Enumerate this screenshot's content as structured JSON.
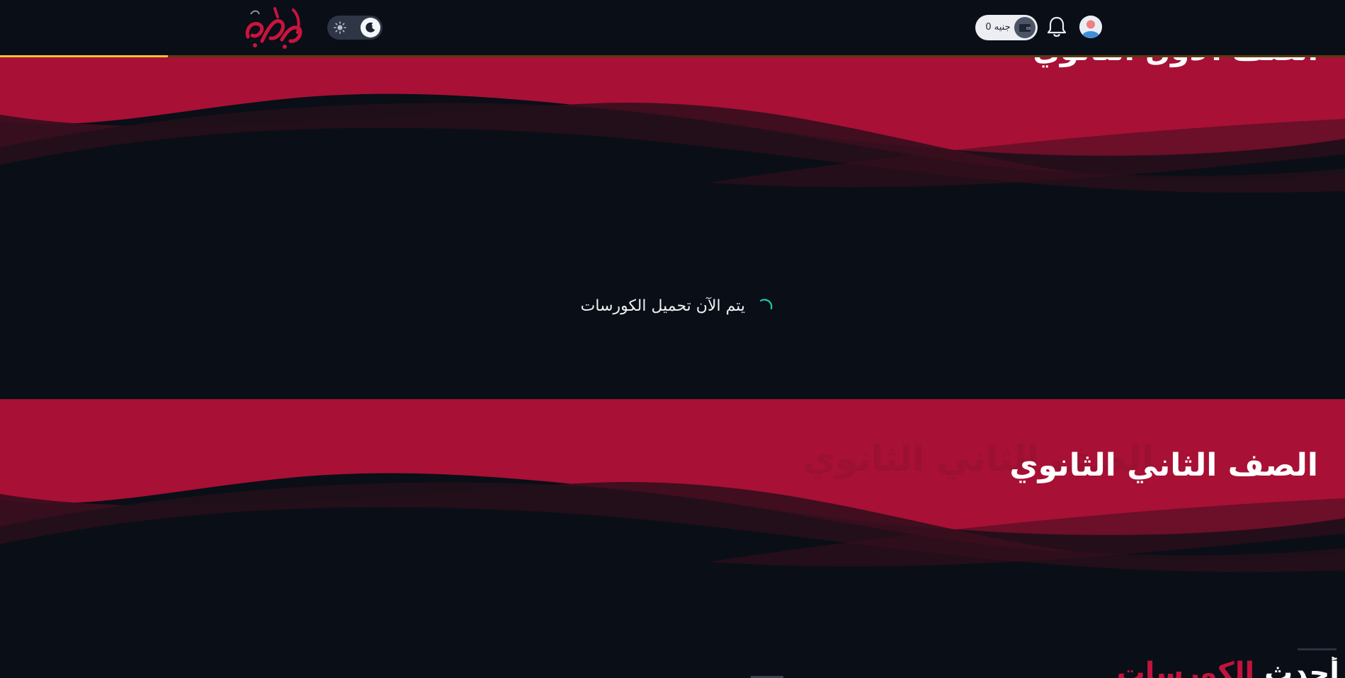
{
  "header": {
    "logo_text": "الحوري",
    "wallet": {
      "amount_label": "0 جنيه",
      "icon": "wallet-icon"
    },
    "notifications_icon": "bell-icon",
    "avatar_icon": "user-avatar-icon",
    "theme_toggle": {
      "light_icon": "sun-icon",
      "dark_icon": "moon-icon",
      "active": "dark"
    },
    "page_progress": 0.125
  },
  "sections": {
    "top_title_peek": "الصف الأول الثانوي",
    "loading_text": "يتم الآن تحميل الكورسات",
    "grade_title": "الصف الثاني الثانوي",
    "grade_title_ghost": "الصف الثاني الثانوي",
    "bottom_title_word1": "أحدث",
    "bottom_title_word2": "الكورسات"
  },
  "colors": {
    "background": "#0a0e17",
    "brand_red": "#a81036",
    "accent_yellow": "#f2c230",
    "spinner": "#1ec8b0"
  }
}
